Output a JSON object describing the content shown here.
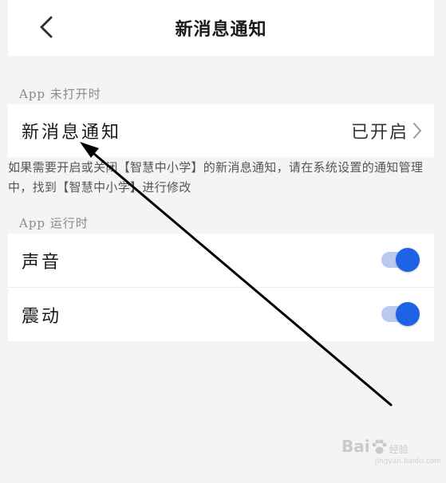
{
  "header": {
    "title": "新消息通知"
  },
  "section_closed": {
    "label": "App 未打开时",
    "row": {
      "label": "新消息通知",
      "value": "已开启"
    },
    "hint": "如果需要开启或关闭【智慧中小学】的新消息通知，请在系统设置的通知管理中，找到【智慧中小学】进行修改"
  },
  "section_running": {
    "label": "App 运行时",
    "rows": [
      {
        "label": "声音",
        "enabled": true
      },
      {
        "label": "震动",
        "enabled": true
      }
    ]
  },
  "watermark": {
    "brand": "Bai",
    "sub": "经验",
    "url": "jingyan.baidu.com"
  },
  "colors": {
    "accent": "#1f62e6",
    "track": "#b9c9f2",
    "background": "#f4f4f6"
  }
}
